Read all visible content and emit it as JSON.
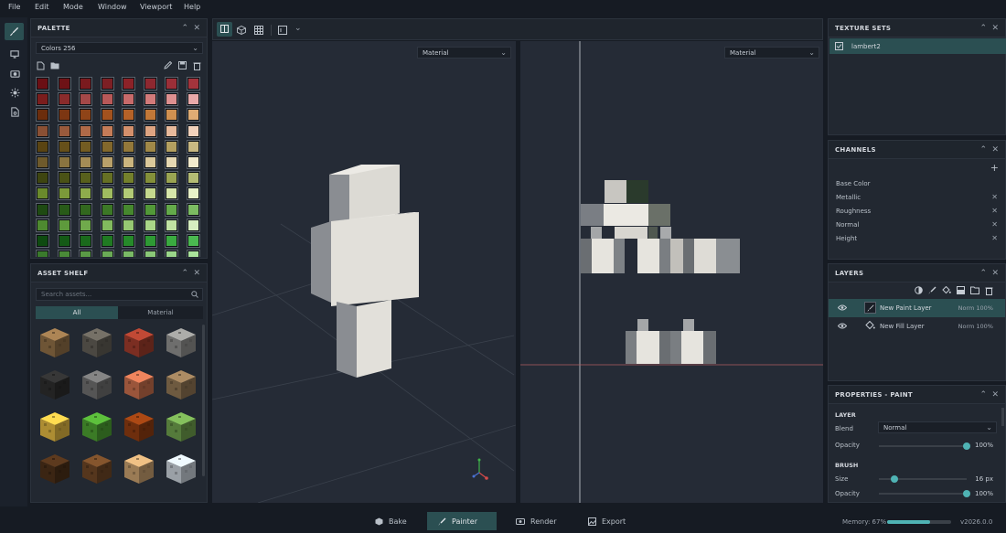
{
  "menu": [
    "File",
    "Edit",
    "Mode",
    "Window",
    "Viewport",
    "Help"
  ],
  "palette": {
    "title": "PALETTE",
    "selected": "Colors 256",
    "colors": [
      [
        "#6b0f14",
        "#6e1216",
        "#7a1a1e",
        "#7d1f24",
        "#8c2228",
        "#8e2830",
        "#9b2f38",
        "#a3343c"
      ],
      [
        "#7a1d1d",
        "#8a2b2b",
        "#a44848",
        "#b85858",
        "#c86a6a",
        "#d27a7a",
        "#de9090",
        "#eaa9a9"
      ],
      [
        "#6b2d0c",
        "#7c3612",
        "#8f4418",
        "#a2521e",
        "#b56228",
        "#c27838",
        "#d09050",
        "#dfac74"
      ],
      [
        "#8a5034",
        "#9a5a3c",
        "#b06a48",
        "#c47c58",
        "#d4906c",
        "#dea482",
        "#e8ba9c",
        "#f2d2bc"
      ],
      [
        "#5a4412",
        "#66501a",
        "#735c22",
        "#82682c",
        "#93783a",
        "#a08848",
        "#b4a060",
        "#c8b882"
      ],
      [
        "#6e5a2c",
        "#8a7440",
        "#a48c56",
        "#b8a06a",
        "#cab47e",
        "#dac89a",
        "#e6d8b2",
        "#f2eacc"
      ],
      [
        "#3e4510",
        "#4a5216",
        "#58601c",
        "#667024",
        "#74802c",
        "#84903a",
        "#9aa452",
        "#b4bc74"
      ],
      [
        "#6a8a2c",
        "#7c9a3a",
        "#8eac4c",
        "#a0bc60",
        "#b2ca76",
        "#c4d88e",
        "#d6e6aa",
        "#e8f2c8"
      ],
      [
        "#1e4a12",
        "#285a18",
        "#32681e",
        "#3c7826",
        "#46882e",
        "#529838",
        "#64aa4a",
        "#7cbc62"
      ],
      [
        "#4e8a30",
        "#5e9a3c",
        "#70aa4c",
        "#82ba5e",
        "#96c872",
        "#aad688",
        "#c0e2a2",
        "#d6eec0"
      ],
      [
        "#0e4a10",
        "#145a16",
        "#1a6a1c",
        "#207a22",
        "#268a2a",
        "#2e9a34",
        "#3aaa40",
        "#4ab850"
      ],
      [
        "#3a7a2c",
        "#4a8a38",
        "#5a9a46",
        "#6aaa56",
        "#7aba66",
        "#8ac878",
        "#9ad68a",
        "#aae49c"
      ]
    ]
  },
  "asset_shelf": {
    "title": "ASSET SHELF",
    "search_placeholder": "Search assets...",
    "tabs": [
      "All",
      "Material"
    ],
    "assets": [
      {
        "name": "dirt-block",
        "color": "#8a6a44"
      },
      {
        "name": "cobble-block",
        "color": "#5e5a52"
      },
      {
        "name": "brick-block",
        "color": "#9a3a2a"
      },
      {
        "name": "stone-brick-block",
        "color": "#8a8a88"
      },
      {
        "name": "coal-block",
        "color": "#2c2c2c"
      },
      {
        "name": "gravel-block",
        "color": "#6a6a6a"
      },
      {
        "name": "terracotta-block",
        "color": "#c06a4a"
      },
      {
        "name": "dirt-dark-block",
        "color": "#8a7050"
      },
      {
        "name": "sand-block",
        "color": "#d8b040"
      },
      {
        "name": "grass-block",
        "color": "#4a9a30"
      },
      {
        "name": "lava-block",
        "color": "#8a3a10"
      },
      {
        "name": "moss-block",
        "color": "#6a9a4a"
      },
      {
        "name": "dark-wood-block",
        "color": "#4a2e18"
      },
      {
        "name": "wood-block",
        "color": "#6a4424"
      },
      {
        "name": "sandstone-block",
        "color": "#c09a6a"
      },
      {
        "name": "snow-block",
        "color": "#c0c8d0"
      }
    ]
  },
  "viewport": {
    "left_mode": "Material",
    "right_mode": "Material"
  },
  "texture_sets": {
    "title": "TEXTURE SETS",
    "items": [
      "lambert2"
    ]
  },
  "channels": {
    "title": "CHANNELS",
    "items": [
      "Base Color",
      "Metallic",
      "Roughness",
      "Normal",
      "Height"
    ]
  },
  "layers": {
    "title": "LAYERS",
    "items": [
      {
        "name": "New Paint Layer",
        "mode": "Norm 100%"
      },
      {
        "name": "New Fill Layer",
        "mode": "Norm 100%"
      }
    ]
  },
  "properties": {
    "title": "PROPERTIES - PAINT",
    "layer_section": "LAYER",
    "blend_label": "Blend",
    "blend_value": "Normal",
    "opacity_label": "Opacity",
    "opacity_value": "100%",
    "opacity_level": 1.0,
    "brush_section": "BRUSH",
    "size_label": "Size",
    "size_value": "16 px",
    "size_level": 0.18,
    "brush_opacity_label": "Opacity",
    "brush_opacity_value": "100%",
    "brush_opacity_level": 1.0
  },
  "bottom": {
    "tabs": [
      "Bake",
      "Painter",
      "Render",
      "Export"
    ],
    "memory_label": "Memory: 67%",
    "memory_level": 0.67,
    "version": "v2026.0.0"
  },
  "colors": {
    "accent": "#4fb3b4",
    "accent_bg": "#2b4f52"
  }
}
